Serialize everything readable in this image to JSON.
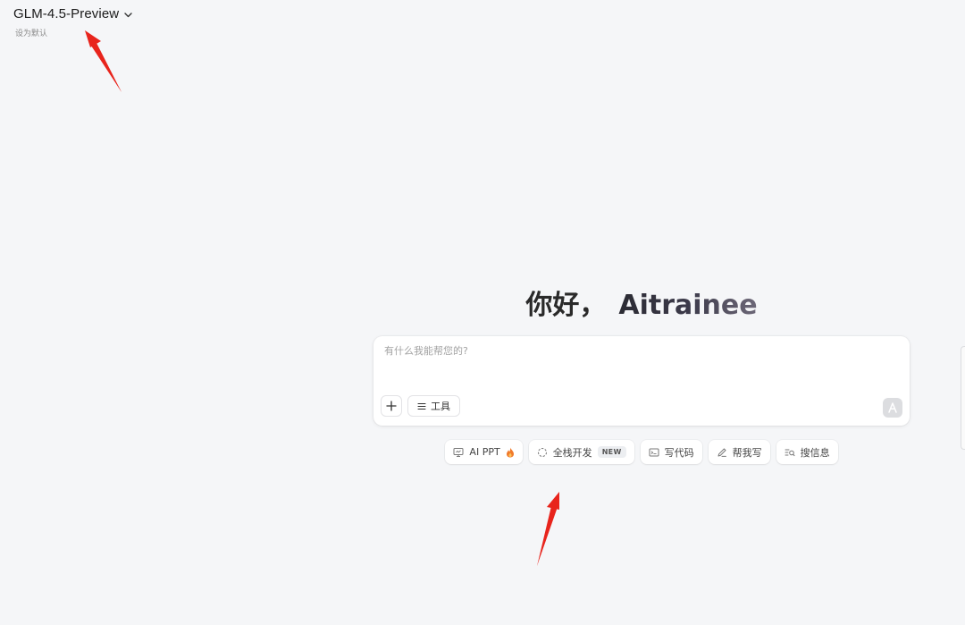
{
  "model_selector": {
    "name": "GLM-4.5-Preview",
    "set_default": "设为默认"
  },
  "greeting": {
    "prefix": "你好，",
    "user": "Aitrainee"
  },
  "input": {
    "placeholder": "有什么我能帮您的?",
    "value": "",
    "tools_label": "工具",
    "send_glyph": "A"
  },
  "quick_actions": [
    {
      "label": "AI PPT",
      "icon": "presentation-icon",
      "suffix_icon": "fire-icon"
    },
    {
      "label": "全栈开发",
      "icon": "loading-circle-icon",
      "badge": "NEW"
    },
    {
      "label": "写代码",
      "icon": "code-window-icon"
    },
    {
      "label": "帮我写",
      "icon": "pen-icon"
    },
    {
      "label": "搜信息",
      "icon": "search-list-icon"
    }
  ],
  "colors": {
    "background": "#f5f6f8",
    "card": "#ffffff",
    "annotation_arrow": "#e8241c",
    "fire": "#f07a2a"
  }
}
